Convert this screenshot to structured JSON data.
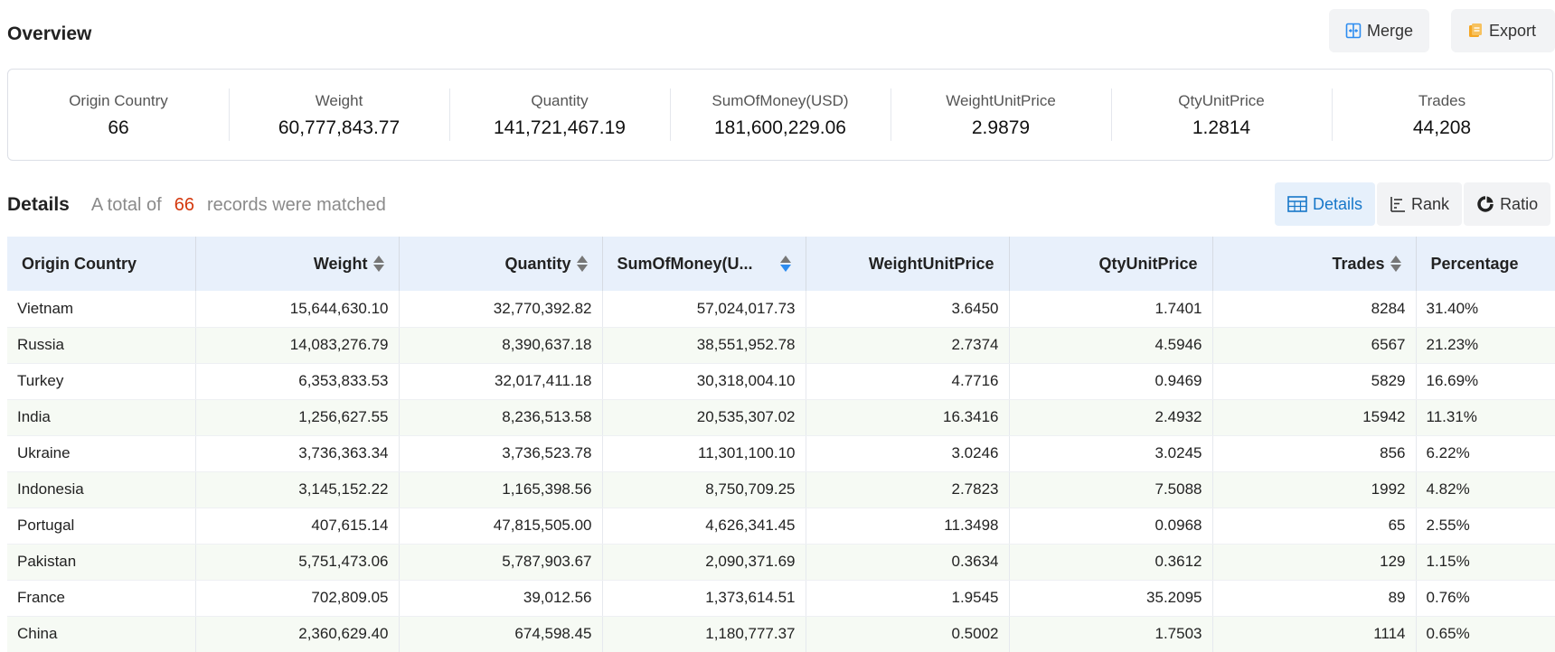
{
  "overview": {
    "title": "Overview",
    "merge_label": "Merge",
    "export_label": "Export",
    "stats": [
      {
        "label": "Origin Country",
        "value": "66"
      },
      {
        "label": "Weight",
        "value": "60,777,843.77"
      },
      {
        "label": "Quantity",
        "value": "141,721,467.19"
      },
      {
        "label": "SumOfMoney(USD)",
        "value": "181,600,229.06"
      },
      {
        "label": "WeightUnitPrice",
        "value": "2.9879"
      },
      {
        "label": "QtyUnitPrice",
        "value": "1.2814"
      },
      {
        "label": "Trades",
        "value": "44,208"
      }
    ]
  },
  "details": {
    "title": "Details",
    "note_prefix": "A total of",
    "count": "66",
    "note_suffix": "records were matched",
    "tabs": {
      "details": "Details",
      "rank": "Rank",
      "ratio": "Ratio"
    }
  },
  "table": {
    "headers": [
      "Origin Country",
      "Weight",
      "Quantity",
      "SumOfMoney(U...",
      "WeightUnitPrice",
      "QtyUnitPrice",
      "Trades",
      "Percentage"
    ],
    "rows": [
      [
        "Vietnam",
        "15,644,630.10",
        "32,770,392.82",
        "57,024,017.73",
        "3.6450",
        "1.7401",
        "8284",
        "31.40%"
      ],
      [
        "Russia",
        "14,083,276.79",
        "8,390,637.18",
        "38,551,952.78",
        "2.7374",
        "4.5946",
        "6567",
        "21.23%"
      ],
      [
        "Turkey",
        "6,353,833.53",
        "32,017,411.18",
        "30,318,004.10",
        "4.7716",
        "0.9469",
        "5829",
        "16.69%"
      ],
      [
        "India",
        "1,256,627.55",
        "8,236,513.58",
        "20,535,307.02",
        "16.3416",
        "2.4932",
        "15942",
        "11.31%"
      ],
      [
        "Ukraine",
        "3,736,363.34",
        "3,736,523.78",
        "11,301,100.10",
        "3.0246",
        "3.0245",
        "856",
        "6.22%"
      ],
      [
        "Indonesia",
        "3,145,152.22",
        "1,165,398.56",
        "8,750,709.25",
        "2.7823",
        "7.5088",
        "1992",
        "4.82%"
      ],
      [
        "Portugal",
        "407,615.14",
        "47,815,505.00",
        "4,626,341.45",
        "11.3498",
        "0.0968",
        "65",
        "2.55%"
      ],
      [
        "Pakistan",
        "5,751,473.06",
        "5,787,903.67",
        "2,090,371.69",
        "0.3634",
        "0.3612",
        "129",
        "1.15%"
      ],
      [
        "France",
        "702,809.05",
        "39,012.56",
        "1,373,614.51",
        "1.9545",
        "35.2095",
        "89",
        "0.76%"
      ],
      [
        "China",
        "2,360,629.40",
        "674,598.45",
        "1,180,777.37",
        "0.5002",
        "1.7503",
        "1114",
        "0.65%"
      ]
    ]
  },
  "colors": {
    "accent": "#1677c9",
    "count_red": "#d4380d",
    "header_bg": "#e8f0fb",
    "stripe": "#f6faf4"
  }
}
